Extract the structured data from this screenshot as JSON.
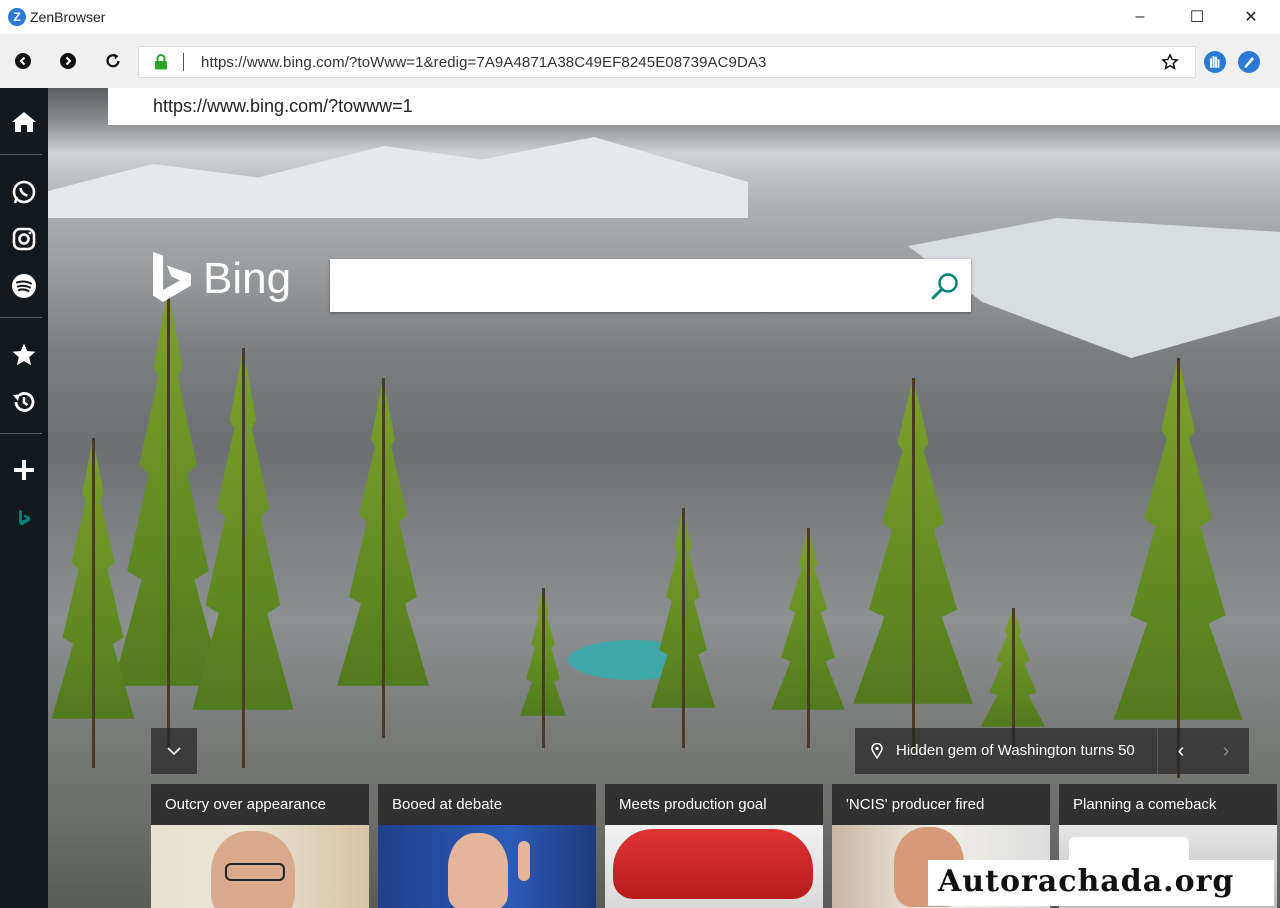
{
  "window": {
    "app_logo": "Z",
    "title": "ZenBrowser",
    "minimize": "–",
    "maximize": "☐",
    "close": "✕"
  },
  "toolbar": {
    "back_icon": "back-icon",
    "forward_icon": "forward-icon",
    "reload_icon": "reload-icon",
    "url": "https://www.bing.com/?toWww=1&redig=7A9A4871A38C49EF8245E08739AC9DA3",
    "bookmark_icon": "star-outline-icon",
    "extensions": [
      "blue-hand-icon",
      "blue-pen-icon"
    ]
  },
  "url_suggestion": "https://www.bing.com/?towww=1",
  "sidebar": {
    "items": [
      {
        "name": "home-icon"
      },
      {
        "name": "whatsapp-icon"
      },
      {
        "name": "instagram-icon"
      },
      {
        "name": "spotify-icon"
      },
      {
        "name": "favorites-star-icon"
      },
      {
        "name": "history-icon"
      },
      {
        "name": "add-icon"
      },
      {
        "name": "bing-icon"
      }
    ]
  },
  "bing": {
    "logo_text": "Bing",
    "search_placeholder": ""
  },
  "caption": {
    "text": "Hidden gem of Washington turns 50",
    "prev": "‹",
    "next": "›"
  },
  "news": [
    {
      "title": "Outcry over appearance"
    },
    {
      "title": "Booed at debate"
    },
    {
      "title": "Meets production goal"
    },
    {
      "title": "'NCIS' producer fired"
    },
    {
      "title": "Planning a comeback"
    }
  ],
  "watermark": "Autorachada.org",
  "colors": {
    "sidebar_bg": "#14191e",
    "accent_blue": "#2a7ad5",
    "lock_green": "#2aa52a",
    "bing_teal": "#008373"
  }
}
